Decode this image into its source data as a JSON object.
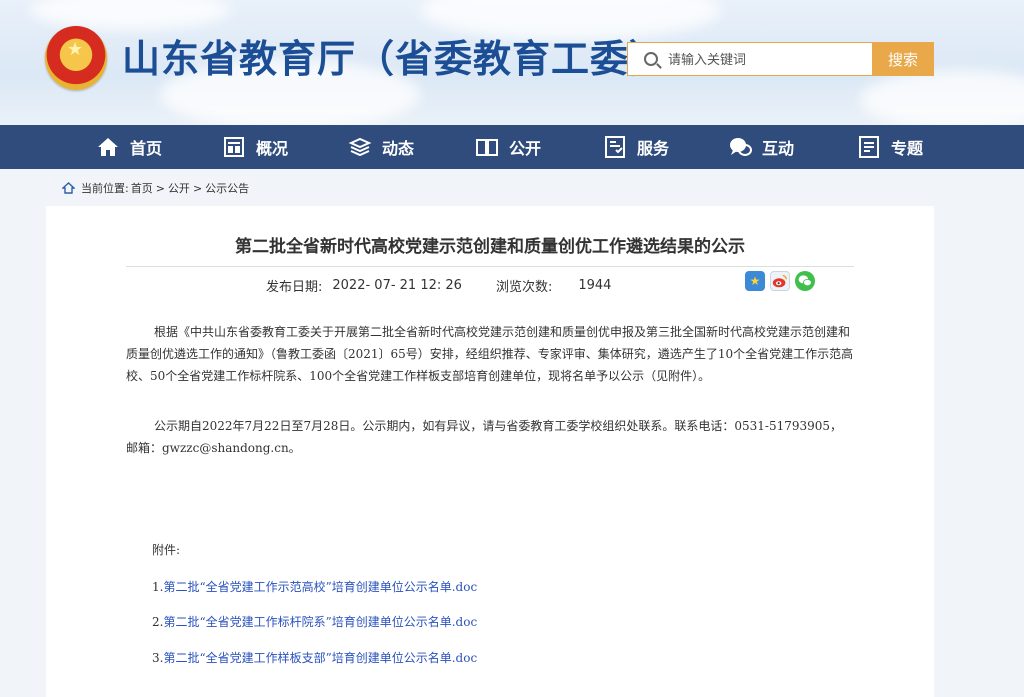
{
  "header": {
    "site_title": "山东省教育厅（省委教育工委）",
    "search_placeholder": "请输入关键词",
    "search_button": "搜索"
  },
  "nav": {
    "items": [
      {
        "label": "首页",
        "icon": "home-icon"
      },
      {
        "label": "概况",
        "icon": "overview-icon"
      },
      {
        "label": "动态",
        "icon": "news-stack-icon"
      },
      {
        "label": "公开",
        "icon": "book-icon"
      },
      {
        "label": "服务",
        "icon": "service-doc-icon"
      },
      {
        "label": "互动",
        "icon": "chat-bubble-icon"
      },
      {
        "label": "专题",
        "icon": "topic-list-icon"
      }
    ]
  },
  "breadcrumb": {
    "prefix": "当前位置:",
    "items": [
      "首页",
      "公开",
      "公示公告"
    ],
    "separator": ">"
  },
  "article": {
    "title": "第二批全省新时代高校党建示范创建和质量创优工作遴选结果的公示",
    "publish_label": "发布日期:",
    "publish_date": "2022- 07- 21 12: 26",
    "views_label": "浏览次数:",
    "views": "1944",
    "share_icons": [
      "favorite-star-icon",
      "weibo-icon",
      "wechat-icon"
    ],
    "paragraphs": [
      "根据《中共山东省委教育工委关于开展第二批全省新时代高校党建示范创建和质量创优申报及第三批全国新时代高校党建示范创建和质量创优遴选工作的通知》（鲁教工委函〔2021〕65号）安排，经组织推荐、专家评审、集体研究，遴选产生了10个全省党建工作示范高校、50个全省党建工作标杆院系、100个全省党建工作样板支部培育创建单位，现将名单予以公示（见附件）。",
      "公示期自2022年7月22日至7月28日。公示期内，如有异议，请与省委教育工委学校组织处联系。联系电话：0531-51793905，邮箱：gwzzc@shandong.cn。"
    ],
    "attachments_label": "附件:",
    "attachments": [
      {
        "num": "1.",
        "label": "第二批“全省党建工作示范高校”培育创建单位公示名单.doc"
      },
      {
        "num": "2.",
        "label": "第二批“全省党建工作标杆院系”培育创建单位公示名单.doc"
      },
      {
        "num": "3.",
        "label": "第二批“全省党建工作样板支部”培育创建单位公示名单.doc"
      }
    ]
  },
  "colors": {
    "nav_bg": "#2f4c7c",
    "title_blue": "#1c4e96",
    "search_orange": "#e9a84a",
    "link_blue": "#2a52be"
  }
}
